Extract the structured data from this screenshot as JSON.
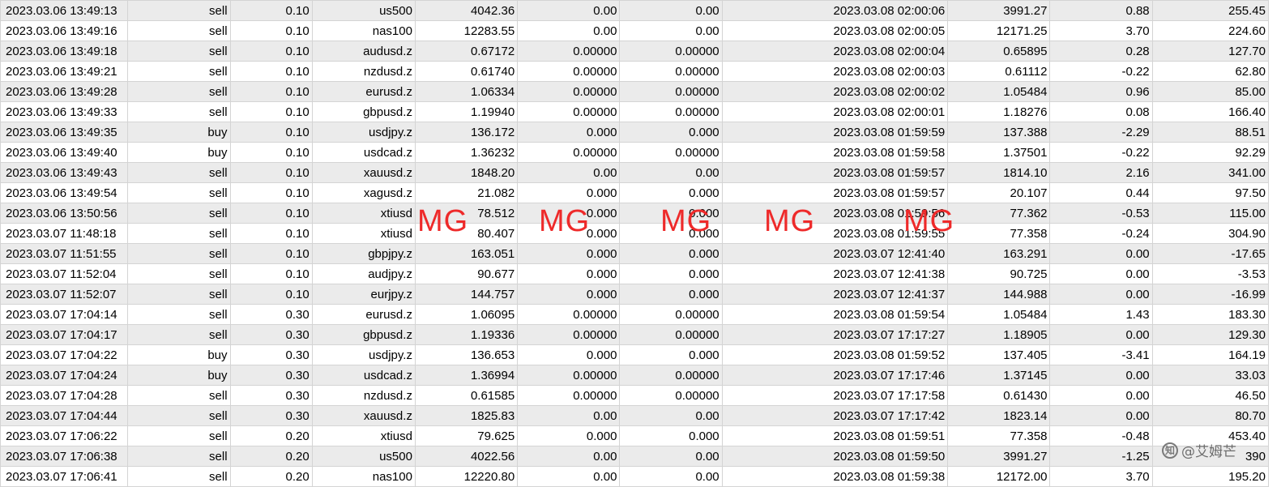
{
  "rows": [
    [
      "2023.03.06 13:49:13",
      "sell",
      "0.10",
      "us500",
      "4042.36",
      "0.00",
      "0.00",
      "2023.03.08 02:00:06",
      "3991.27",
      "0.88",
      "255.45"
    ],
    [
      "2023.03.06 13:49:16",
      "sell",
      "0.10",
      "nas100",
      "12283.55",
      "0.00",
      "0.00",
      "2023.03.08 02:00:05",
      "12171.25",
      "3.70",
      "224.60"
    ],
    [
      "2023.03.06 13:49:18",
      "sell",
      "0.10",
      "audusd.z",
      "0.67172",
      "0.00000",
      "0.00000",
      "2023.03.08 02:00:04",
      "0.65895",
      "0.28",
      "127.70"
    ],
    [
      "2023.03.06 13:49:21",
      "sell",
      "0.10",
      "nzdusd.z",
      "0.61740",
      "0.00000",
      "0.00000",
      "2023.03.08 02:00:03",
      "0.61112",
      "-0.22",
      "62.80"
    ],
    [
      "2023.03.06 13:49:28",
      "sell",
      "0.10",
      "eurusd.z",
      "1.06334",
      "0.00000",
      "0.00000",
      "2023.03.08 02:00:02",
      "1.05484",
      "0.96",
      "85.00"
    ],
    [
      "2023.03.06 13:49:33",
      "sell",
      "0.10",
      "gbpusd.z",
      "1.19940",
      "0.00000",
      "0.00000",
      "2023.03.08 02:00:01",
      "1.18276",
      "0.08",
      "166.40"
    ],
    [
      "2023.03.06 13:49:35",
      "buy",
      "0.10",
      "usdjpy.z",
      "136.172",
      "0.000",
      "0.000",
      "2023.03.08 01:59:59",
      "137.388",
      "-2.29",
      "88.51"
    ],
    [
      "2023.03.06 13:49:40",
      "buy",
      "0.10",
      "usdcad.z",
      "1.36232",
      "0.00000",
      "0.00000",
      "2023.03.08 01:59:58",
      "1.37501",
      "-0.22",
      "92.29"
    ],
    [
      "2023.03.06 13:49:43",
      "sell",
      "0.10",
      "xauusd.z",
      "1848.20",
      "0.00",
      "0.00",
      "2023.03.08 01:59:57",
      "1814.10",
      "2.16",
      "341.00"
    ],
    [
      "2023.03.06 13:49:54",
      "sell",
      "0.10",
      "xagusd.z",
      "21.082",
      "0.000",
      "0.000",
      "2023.03.08 01:59:57",
      "20.107",
      "0.44",
      "97.50"
    ],
    [
      "2023.03.06 13:50:56",
      "sell",
      "0.10",
      "xtiusd",
      "78.512",
      "0.000",
      "0.000",
      "2023.03.08 01:59:56",
      "77.362",
      "-0.53",
      "115.00"
    ],
    [
      "2023.03.07 11:48:18",
      "sell",
      "0.10",
      "xtiusd",
      "80.407",
      "0.000",
      "0.000",
      "2023.03.08 01:59:55",
      "77.358",
      "-0.24",
      "304.90"
    ],
    [
      "2023.03.07 11:51:55",
      "sell",
      "0.10",
      "gbpjpy.z",
      "163.051",
      "0.000",
      "0.000",
      "2023.03.07 12:41:40",
      "163.291",
      "0.00",
      "-17.65"
    ],
    [
      "2023.03.07 11:52:04",
      "sell",
      "0.10",
      "audjpy.z",
      "90.677",
      "0.000",
      "0.000",
      "2023.03.07 12:41:38",
      "90.725",
      "0.00",
      "-3.53"
    ],
    [
      "2023.03.07 11:52:07",
      "sell",
      "0.10",
      "eurjpy.z",
      "144.757",
      "0.000",
      "0.000",
      "2023.03.07 12:41:37",
      "144.988",
      "0.00",
      "-16.99"
    ],
    [
      "2023.03.07 17:04:14",
      "sell",
      "0.30",
      "eurusd.z",
      "1.06095",
      "0.00000",
      "0.00000",
      "2023.03.08 01:59:54",
      "1.05484",
      "1.43",
      "183.30"
    ],
    [
      "2023.03.07 17:04:17",
      "sell",
      "0.30",
      "gbpusd.z",
      "1.19336",
      "0.00000",
      "0.00000",
      "2023.03.07 17:17:27",
      "1.18905",
      "0.00",
      "129.30"
    ],
    [
      "2023.03.07 17:04:22",
      "buy",
      "0.30",
      "usdjpy.z",
      "136.653",
      "0.000",
      "0.000",
      "2023.03.08 01:59:52",
      "137.405",
      "-3.41",
      "164.19"
    ],
    [
      "2023.03.07 17:04:24",
      "buy",
      "0.30",
      "usdcad.z",
      "1.36994",
      "0.00000",
      "0.00000",
      "2023.03.07 17:17:46",
      "1.37145",
      "0.00",
      "33.03"
    ],
    [
      "2023.03.07 17:04:28",
      "sell",
      "0.30",
      "nzdusd.z",
      "0.61585",
      "0.00000",
      "0.00000",
      "2023.03.07 17:17:58",
      "0.61430",
      "0.00",
      "46.50"
    ],
    [
      "2023.03.07 17:04:44",
      "sell",
      "0.30",
      "xauusd.z",
      "1825.83",
      "0.00",
      "0.00",
      "2023.03.07 17:17:42",
      "1823.14",
      "0.00",
      "80.70"
    ],
    [
      "2023.03.07 17:06:22",
      "sell",
      "0.20",
      "xtiusd",
      "79.625",
      "0.000",
      "0.000",
      "2023.03.08 01:59:51",
      "77.358",
      "-0.48",
      "453.40"
    ],
    [
      "2023.03.07 17:06:38",
      "sell",
      "0.20",
      "us500",
      "4022.56",
      "0.00",
      "0.00",
      "2023.03.08 01:59:50",
      "3991.27",
      "-1.25",
      "390"
    ],
    [
      "2023.03.07 17:06:41",
      "sell",
      "0.20",
      "nas100",
      "12220.80",
      "0.00",
      "0.00",
      "2023.03.08 01:59:38",
      "12172.00",
      "3.70",
      "195.20"
    ]
  ],
  "watermark": {
    "text": "MG",
    "color": "#ee2a2a"
  },
  "badge": {
    "icon": "zhihu-icon",
    "icon_glyph": "知",
    "text": "@艾姆芒"
  }
}
